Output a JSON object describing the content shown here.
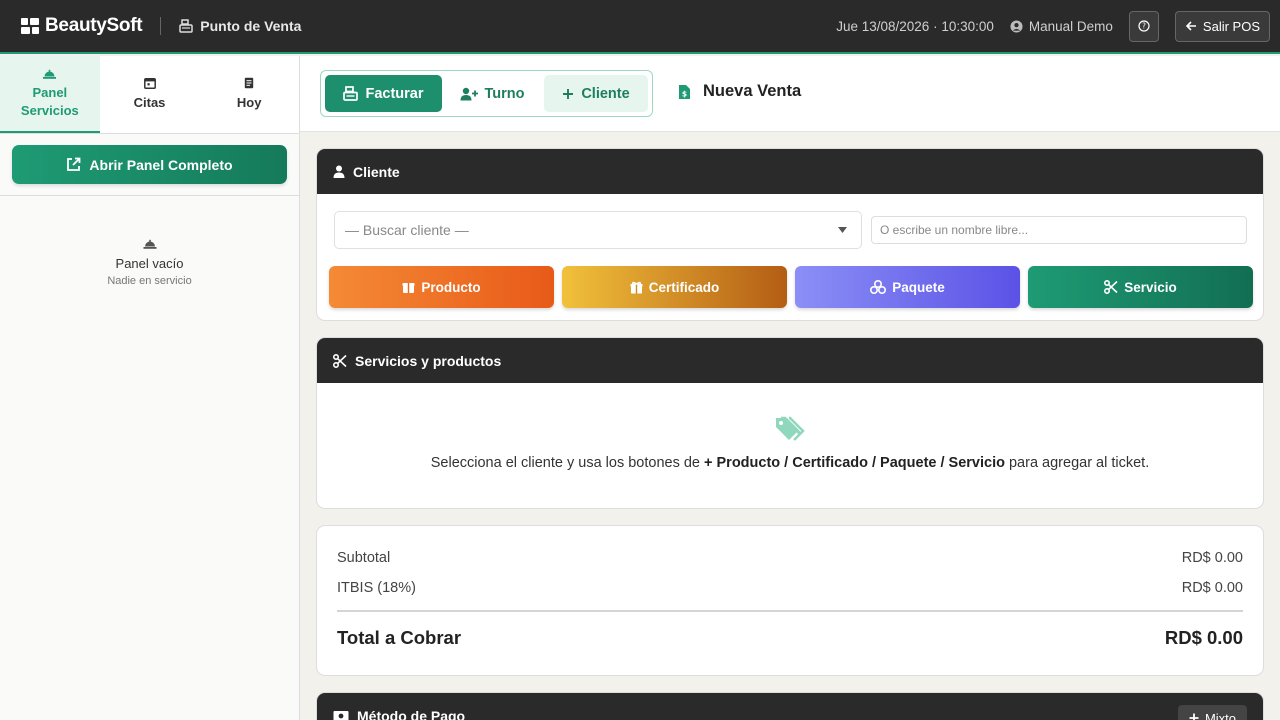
{
  "app": {
    "brand": "BeautySoft",
    "module": "Punto de Venta",
    "datetime": "Jue 13/08/2026 · 10:30:00",
    "user": "Manual Demo",
    "help_label": "?",
    "exit_label": "Salir POS"
  },
  "sidebar": {
    "tabs": [
      {
        "label": "Panel\nServicios",
        "icon": "bell-icon",
        "active": true
      },
      {
        "label": "Citas",
        "icon": "calendar-icon",
        "active": false
      },
      {
        "label": "Hoy",
        "icon": "receipt-icon",
        "active": false
      }
    ],
    "open_panel_label": "Abrir Panel Completo",
    "empty_title": "Panel vacío",
    "empty_subtitle": "Nadie en servicio"
  },
  "header": {
    "actions": [
      {
        "label": "Facturar",
        "icon": "cash-register-icon"
      },
      {
        "label": "Turno",
        "icon": "user-plus-icon"
      },
      {
        "label": "Cliente",
        "icon": "plus-icon"
      }
    ],
    "sale_title": "Nueva Venta"
  },
  "client": {
    "title": "Cliente",
    "select_placeholder": "— Buscar cliente —",
    "free_name_placeholder": "O escribe un nombre libre...",
    "buttons": [
      {
        "label": "Producto",
        "icon": "box-icon"
      },
      {
        "label": "Certificado",
        "icon": "gift-icon"
      },
      {
        "label": "Paquete",
        "icon": "boxes-icon"
      },
      {
        "label": "Servicio",
        "icon": "scissors-icon"
      }
    ]
  },
  "items": {
    "title": "Servicios y productos",
    "msg_pre": "Selecciona el cliente y usa los botones de ",
    "msg_bold": "+ Producto / Certificado / Paquete / Servicio",
    "msg_post": " para agregar al ticket."
  },
  "totals": {
    "subtotal_label": "Subtotal",
    "subtotal_value": "RD$ 0.00",
    "tax_label": "ITBIS (18%)",
    "tax_value": "RD$ 0.00",
    "total_label": "Total a Cobrar",
    "total_value": "RD$ 0.00"
  },
  "payment": {
    "title": "Método de Pago",
    "mixto_label": "Mixto"
  },
  "colors": {
    "accent": "#1e9b74",
    "dark": "#2a2a2a"
  }
}
